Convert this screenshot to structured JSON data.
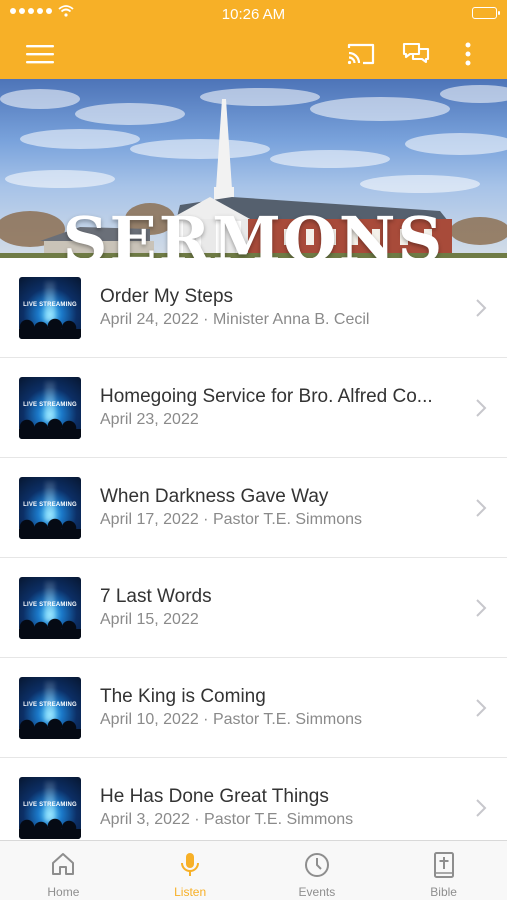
{
  "status_bar": {
    "time": "10:26 AM"
  },
  "banner": {
    "title": "SERMONS"
  },
  "sermons": [
    {
      "title": "Order My Steps",
      "subtitle": "April 24, 2022 · Minister Anna B. Cecil",
      "thumb_label": "LIVE STREAMING"
    },
    {
      "title": "Homegoing Service for Bro. Alfred Co...",
      "subtitle": "April 23, 2022",
      "thumb_label": "LIVE STREAMING"
    },
    {
      "title": "When Darkness Gave Way",
      "subtitle": "April 17, 2022 · Pastor T.E. Simmons",
      "thumb_label": "LIVE STREAMING"
    },
    {
      "title": "7 Last Words",
      "subtitle": "April 15, 2022",
      "thumb_label": "LIVE STREAMING"
    },
    {
      "title": "The King is Coming",
      "subtitle": "April 10, 2022 · Pastor T.E. Simmons",
      "thumb_label": "LIVE STREAMING"
    },
    {
      "title": "He Has Done Great Things",
      "subtitle": "April 3, 2022 · Pastor T.E. Simmons",
      "thumb_label": "LIVE STREAMING"
    }
  ],
  "tabs": [
    {
      "label": "Home",
      "icon": "home-icon",
      "active": false
    },
    {
      "label": "Listen",
      "icon": "microphone-icon",
      "active": true
    },
    {
      "label": "Events",
      "icon": "clock-icon",
      "active": false
    },
    {
      "label": "Bible",
      "icon": "bible-icon",
      "active": false
    }
  ],
  "colors": {
    "accent": "#f7b027",
    "text": "#333333",
    "subtext": "#8a8a8a",
    "tab_inactive": "#8e8e8e"
  },
  "icons": {
    "menu": "hamburger-menu-icon",
    "cast": "cast-icon",
    "chat": "chat-bubbles-icon",
    "more": "more-vertical-icon",
    "chevron": "chevron-right-icon"
  }
}
